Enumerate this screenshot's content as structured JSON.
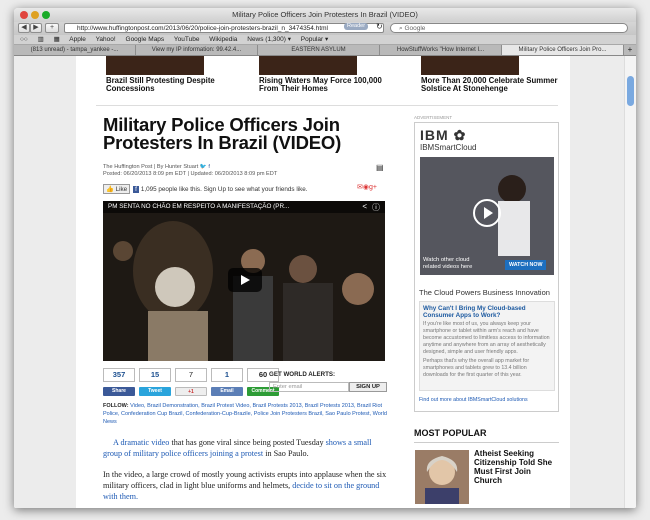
{
  "window": {
    "title": "Military Police Officers Join Protesters In Brazil (VIDEO)"
  },
  "toolbar": {
    "url": "http://www.huffingtonpost.com/2013/06/20/police-join-protesters-brazil_n_3474354.html",
    "reader": "Reader",
    "search_placeholder": "Google"
  },
  "bookmarks": [
    "Apple",
    "Yahoo!",
    "Google Maps",
    "YouTube",
    "Wikipedia",
    "News (1,300) ▾",
    "Popular ▾"
  ],
  "tabs": [
    "(813 unread) - tampa_yankee -...",
    "View my IP information: 99.42.4...",
    "EASTERN ASYLUM",
    "HowStuffWorks \"How Internet I...",
    "Military Police Officers Join Pro..."
  ],
  "top_stories": [
    {
      "caption": "Brazil Still Protesting Despite Concessions"
    },
    {
      "caption": "Rising Waters May Force 100,000 From Their Homes"
    },
    {
      "caption": "More Than 20,000 Celebrate Summer Solstice At Stonehenge"
    }
  ],
  "article": {
    "headline": "Military Police Officers Join Protesters In Brazil (VIDEO)",
    "source": "The Huffington Post  |  By Hunter Stuart",
    "posted": "Posted: 06/20/2013 8:09 pm EDT  |  Updated: 06/20/2013 8:09 pm EDT",
    "like_label": "Like",
    "fb_text": "1,095 people like this. Sign Up to see what your friends like.",
    "video_title": "PM SENTA NO CHÃO EM RESPEITO A MANIFESTAÇÃO (PR...",
    "counts": [
      "357",
      "15",
      "7",
      "1",
      "60"
    ],
    "share_buttons": [
      "Share",
      "Tweet",
      "+1",
      "Email",
      "Comment"
    ],
    "alerts_label": "GET WORLD ALERTS:",
    "email_placeholder": "Enter email",
    "signup": "SIGN UP",
    "follow_label": "FOLLOW:",
    "follow_links": "Video, Brazil Demonstration, Brazil Protest Video, Brazil Protests 2013, Brazil Protests 2013, Brazil Riot Police, Confederation Cup Brazil, Confederation-Cup-Brazile, Police Join Protesters Brazil, Sao Paulo Protest, World News",
    "p1_a": "A dramatic video",
    "p1_b": " that has gone viral since being posted Tuesday ",
    "p1_c": "shows a small group of military police officers joining a protest",
    "p1_d": " in Sao Paulo.",
    "p2_a": "In the video, a large crowd of mostly young activists erupts into applause when the six military officers, clad in light blue uniforms and helmets, ",
    "p2_b": "decide to sit on the ground with them."
  },
  "ad": {
    "label": "ADVERTISEMENT",
    "logo": "IBM",
    "product": "IBMSmartCloud",
    "watch": "Watch other cloud related videos here",
    "watch_now": "WATCH NOW",
    "headline": "The Cloud Powers Business Innovation",
    "box_title": "Why Can't I Bring My Cloud-based Consumer Apps to Work?",
    "box_p1": "If you're like most of us, you always keep your smartphone or tablet within arm's reach and have become accustomed to limitless access to information anytime and anywhere from an array of aesthetically designed, simple and user friendly apps.",
    "box_p2": "Perhaps that's why the overall app market for smartphones and tablets grew to 13.4 billion downloads for the first quarter of this year.",
    "find_out": "Find out more about IBMSmartCloud solutions"
  },
  "most_popular": {
    "title": "MOST POPULAR",
    "item": "Atheist Seeking Citizenship Told She Must First Join Church"
  }
}
